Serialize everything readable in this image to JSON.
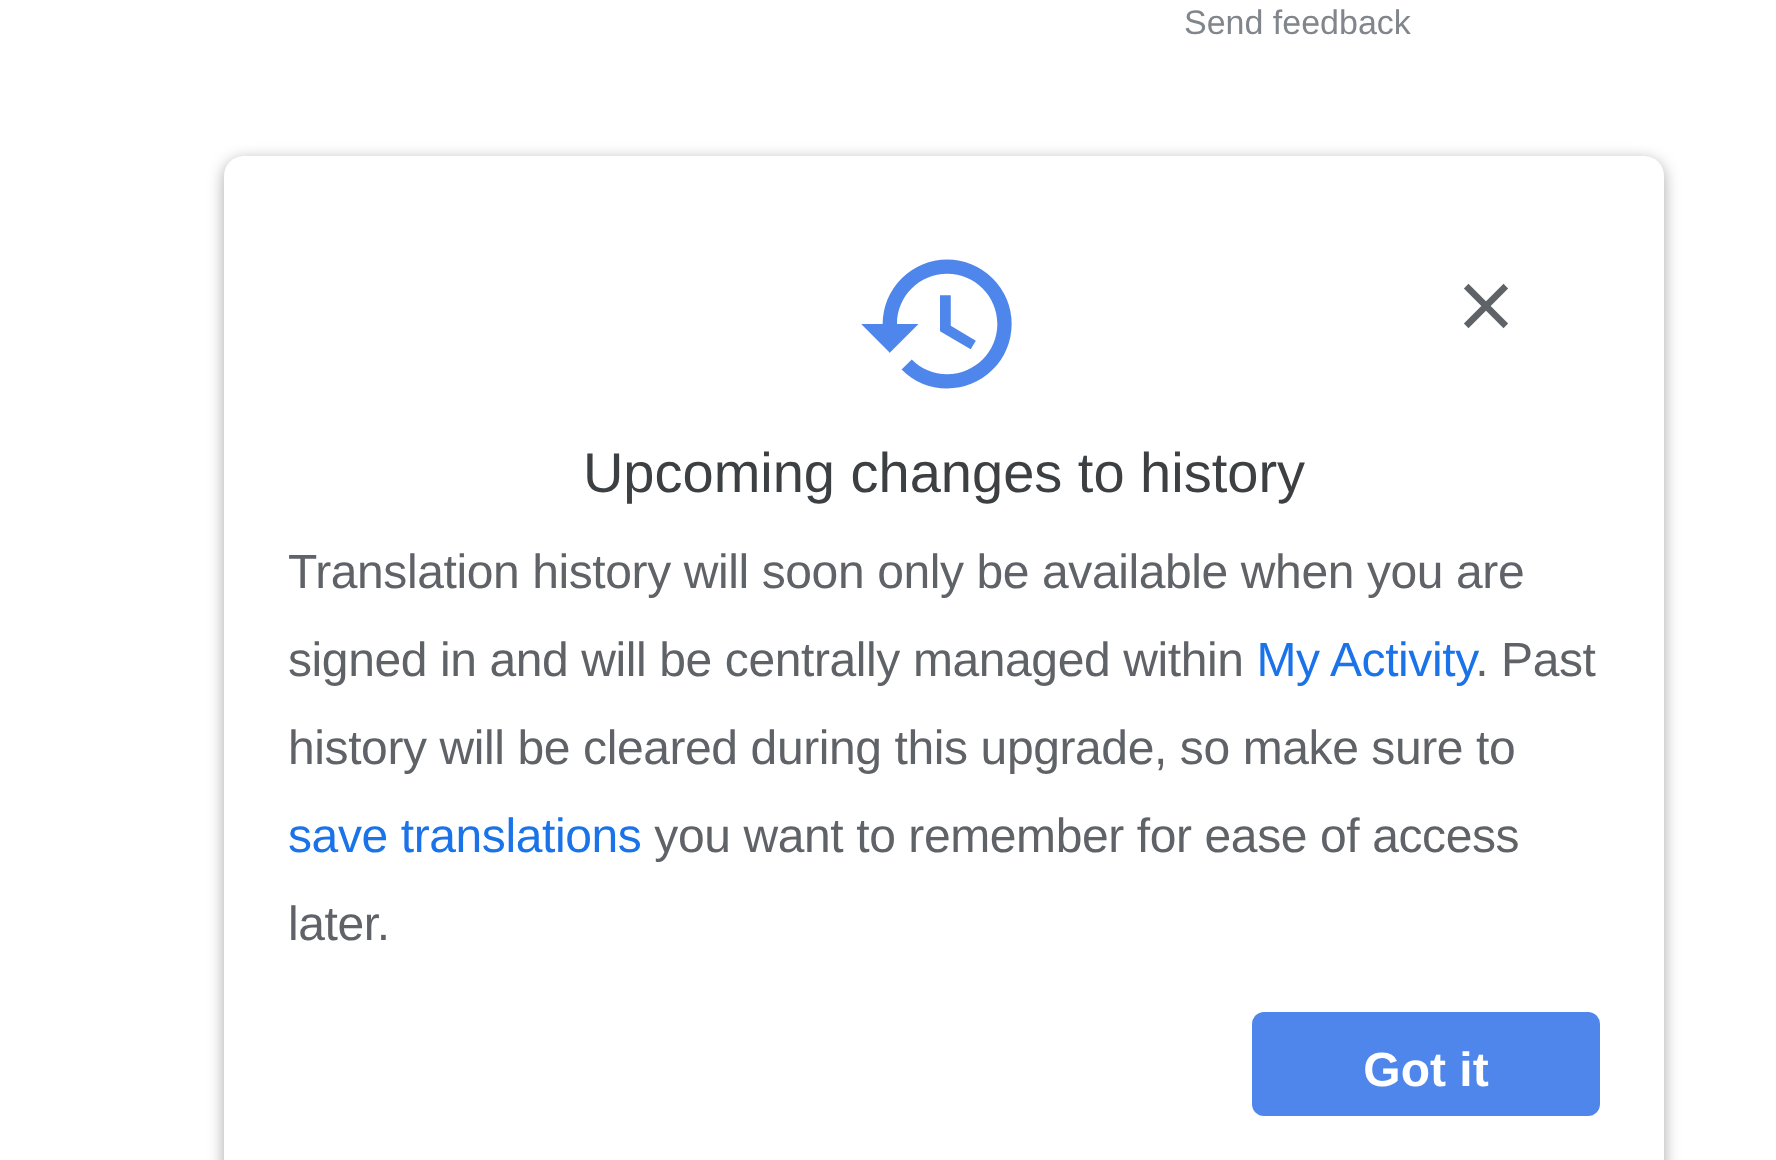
{
  "header_link": "Send feedback",
  "dialog": {
    "title": "Upcoming changes to history",
    "body": [
      {
        "kind": "text",
        "text": "Translation history will soon only be available when you are signed in and will be centrally managed within "
      },
      {
        "kind": "link",
        "text": "My Activity"
      },
      {
        "kind": "text",
        "text": ". Past history will be cleared during this upgrade, so make sure to "
      },
      {
        "kind": "link",
        "text": "save translations"
      },
      {
        "kind": "text",
        "text": " you want to remember for ease of access later."
      }
    ],
    "button": "Got it"
  }
}
